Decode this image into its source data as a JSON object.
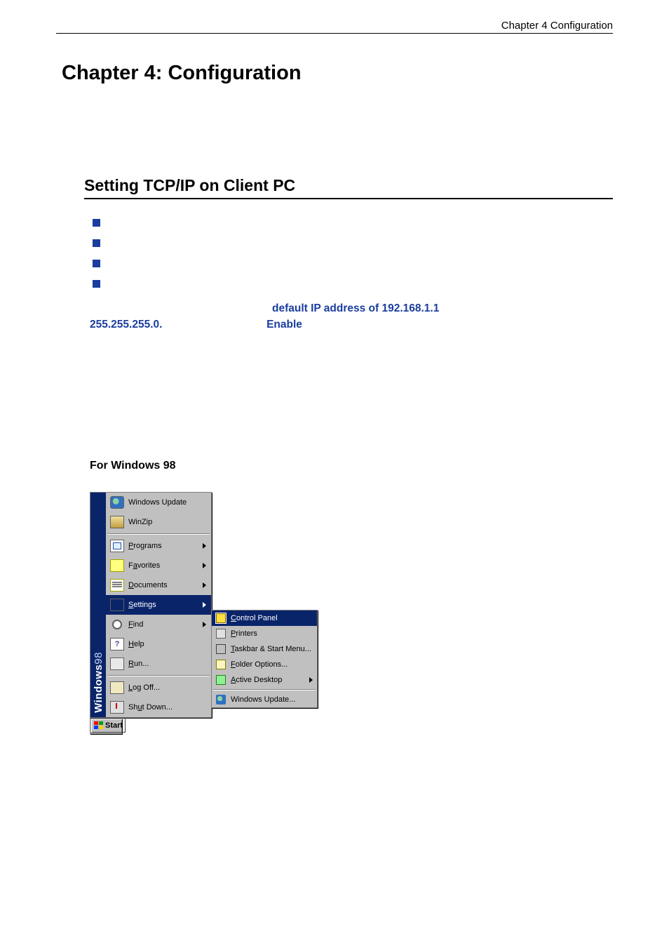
{
  "header": {
    "right_text": "Chapter 4 Configuration"
  },
  "titles": {
    "chapter": "Chapter 4: Configuration",
    "section": "Setting TCP/IP on Client PC",
    "sub": "For Windows 98"
  },
  "blue_text": {
    "line1_right": "default IP address of 192.168.1.1",
    "line2_left": "255.255.255.0.",
    "line2_right": "Enable"
  },
  "start_menu": {
    "side_label_a": "Windows",
    "side_label_b": "98",
    "items": [
      {
        "label": "Windows Update",
        "icon": "globe-icon",
        "arrow": false
      },
      {
        "label": "WinZip",
        "icon": "zip-icon",
        "arrow": false
      },
      {
        "sep": true
      },
      {
        "label": "Programs",
        "u": 0,
        "icon": "programs-icon",
        "arrow": true
      },
      {
        "label": "Favorites",
        "u": 1,
        "icon": "favorites-icon",
        "arrow": true
      },
      {
        "label": "Documents",
        "u": 0,
        "icon": "documents-icon",
        "arrow": true
      },
      {
        "label": "Settings",
        "u": 0,
        "icon": "settings-icon",
        "arrow": true,
        "highlight": true
      },
      {
        "label": "Find",
        "u": 0,
        "icon": "find-icon",
        "arrow": true
      },
      {
        "label": "Help",
        "u": 0,
        "icon": "help-icon",
        "arrow": false
      },
      {
        "label": "Run...",
        "u": 0,
        "icon": "run-icon",
        "arrow": false
      },
      {
        "sep": true
      },
      {
        "label": "Log Off...",
        "u": 0,
        "icon": "logoff-icon",
        "arrow": false
      },
      {
        "label": "Shut Down...",
        "u": 2,
        "icon": "shutdown-icon",
        "arrow": false
      }
    ],
    "submenu": [
      {
        "label": "Control Panel",
        "u": 0,
        "icon": "control-panel-icon",
        "highlight": true
      },
      {
        "label": "Printers",
        "u": 0,
        "icon": "printers-icon"
      },
      {
        "label": "Taskbar & Start Menu...",
        "u": 0,
        "icon": "taskbar-icon"
      },
      {
        "label": "Folder Options...",
        "u": 0,
        "icon": "folder-options-icon"
      },
      {
        "label": "Active Desktop",
        "u": 0,
        "icon": "active-desktop-icon",
        "arrow": true
      },
      {
        "sep": true
      },
      {
        "label": "Windows Update...",
        "icon": "windows-update-icon"
      }
    ],
    "start_button": "Start"
  }
}
